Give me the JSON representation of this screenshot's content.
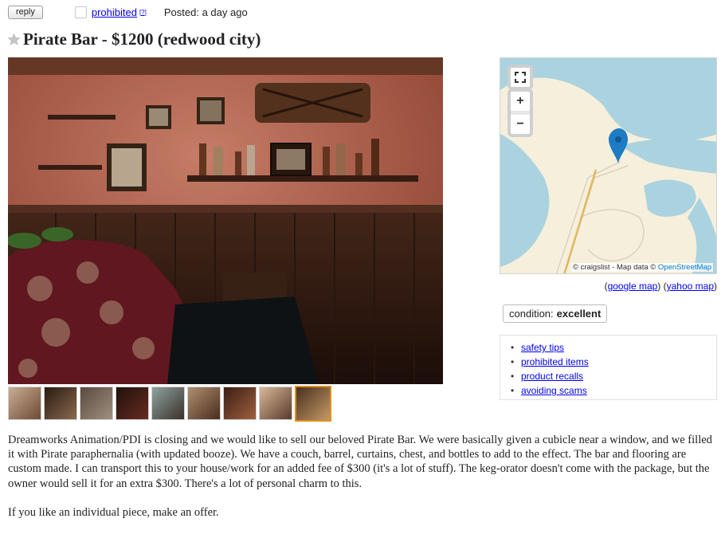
{
  "topbar": {
    "reply_label": "reply",
    "prohibited_label": "prohibited",
    "help_label": "[?]",
    "posted_label": "Posted:",
    "posted_time": "a day ago"
  },
  "posting": {
    "title": "Pirate Bar - $1200 (redwood city)",
    "image_count": 9,
    "selected_thumb": 9
  },
  "map": {
    "fullscreen_icon": "fullscreen-icon",
    "zoom_in_label": "+",
    "zoom_out_label": "−",
    "attribution_prefix": "© craigslist - Map data ©",
    "attribution_link": "OpenStreetMap",
    "links": {
      "open": "(",
      "google": "google map",
      "sep": ") (",
      "yahoo": "yahoo map",
      "close": ")"
    },
    "colors": {
      "water": "#aad3df",
      "land": "#f5efdc",
      "marker": "#1e7bc4"
    }
  },
  "attributes": {
    "condition_label": "condition:",
    "condition_value": "excellent"
  },
  "safety_links": [
    "safety tips",
    "prohibited items",
    "product recalls",
    "avoiding scams"
  ],
  "body": {
    "paragraph1": "Dreamworks Animation/PDI is closing and we would like to sell our beloved Pirate Bar. We were basically given a cubicle near a window, and we filled it with Pirate paraphernalia (with updated booze). We have a couch, barrel, curtains, chest, and bottles to add to the effect. The bar and flooring are custom made. I can transport this to your house/work for an added fee of $300 (it's a lot of stuff). The keg-orator doesn't come with the package, but the owner would sell it for an extra $300. There's a lot of personal charm to this.",
    "paragraph2": "If you like an individual piece, make an offer."
  }
}
